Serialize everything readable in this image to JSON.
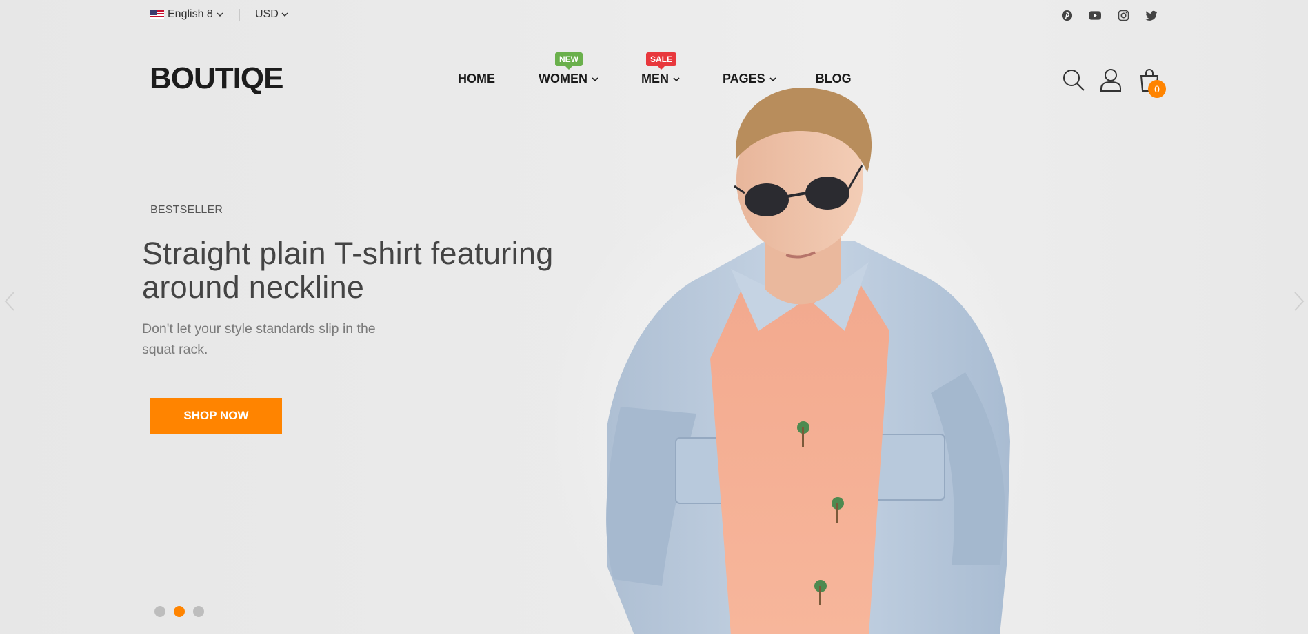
{
  "colors": {
    "accent": "#ff8400",
    "new_tag": "#6ab04c",
    "sale_tag": "#e8383d",
    "background": "#e9e9e9"
  },
  "topbar": {
    "language": {
      "label": "English 8",
      "flag": "us-flag-icon"
    },
    "currency": {
      "label": "USD"
    },
    "socials": [
      "pinterest-icon",
      "youtube-icon",
      "instagram-icon",
      "twitter-icon"
    ]
  },
  "header": {
    "logo": "BOUTIQE",
    "nav": [
      {
        "label": "HOME"
      },
      {
        "label": "WOMEN",
        "badge": "NEW"
      },
      {
        "label": "MEN",
        "badge": "SALE"
      },
      {
        "label": "PAGES"
      },
      {
        "label": "BLOG"
      }
    ],
    "icons": [
      "search-icon",
      "user-icon",
      "cart-icon"
    ],
    "cart_count": "0"
  },
  "hero": {
    "eyebrow": "BESTSELLER",
    "headline": "Straight plain T-shirt featuring around neckline",
    "subtext": "Don't let your style standards slip in the squat rack.",
    "button": "SHOP NOW",
    "slides": 3,
    "active_slide": 2
  }
}
